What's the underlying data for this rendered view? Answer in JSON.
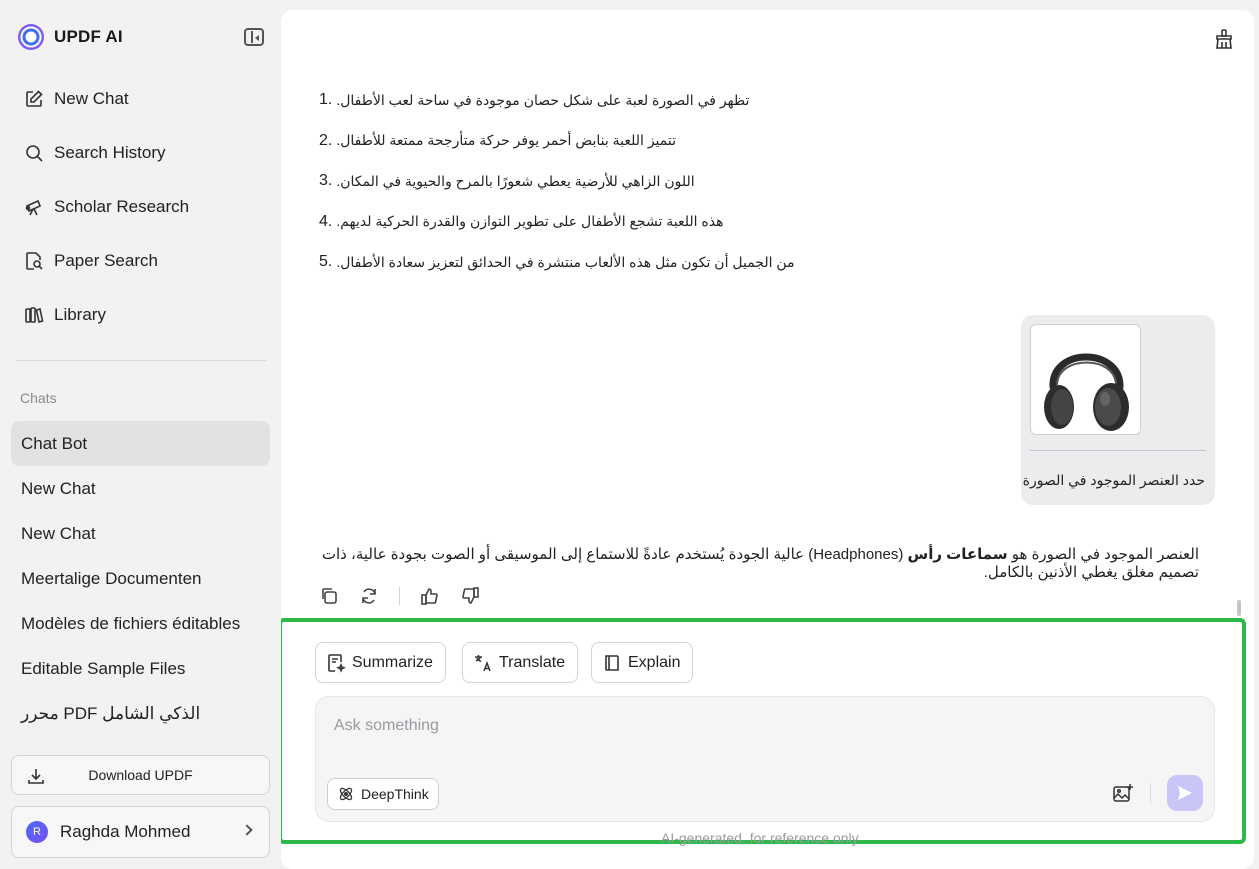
{
  "app": {
    "name": "UPDF AI"
  },
  "sidebar": {
    "nav": [
      {
        "label": "New Chat",
        "icon": "edit-icon"
      },
      {
        "label": "Search History",
        "icon": "search-icon"
      },
      {
        "label": "Scholar Research",
        "icon": "telescope-icon"
      },
      {
        "label": "Paper Search",
        "icon": "document-search-icon"
      },
      {
        "label": "Library",
        "icon": "library-icon"
      }
    ],
    "chats_label": "Chats",
    "chats": [
      "Chat Bot",
      "New Chat",
      "New Chat",
      "Meertalige Documenten",
      "Modèles de fichiers éditables",
      "Editable Sample Files",
      "محرر PDF الذكي الشامل"
    ],
    "active_chat_index": 0,
    "download_label": "Download UPDF",
    "user": {
      "initial": "R",
      "name": "Raghda Mohmed"
    }
  },
  "conversation": {
    "list_items": [
      {
        "num": "1.",
        "text": "تظهر في الصورة لعبة على شكل حصان موجودة في ساحة لعب الأطفال."
      },
      {
        "num": "2.",
        "text": "تتميز اللعبة بنابض أحمر يوفر حركة متأرجحة ممتعة للأطفال."
      },
      {
        "num": "3.",
        "text": "اللون الزاهي للأرضية يعطي شعورًا بالمرح والحيوية في المكان."
      },
      {
        "num": "4.",
        "text": "هذه اللعبة تشجع الأطفال على تطوير التوازن والقدرة الحركية لديهم."
      },
      {
        "num": "5.",
        "text": "من الجميل أن تكون مثل هذه الألعاب منتشرة في الحدائق لتعزيز سعادة الأطفال."
      }
    ],
    "user_message": {
      "image_alt": "headphones",
      "text": "حدد العنصر الموجود في الصورة"
    },
    "answer": {
      "bold": "سماعات رأس",
      "text_part1": "العنصر الموجود في الصورة هو ",
      "text_part2": " (Headphones) عالية الجودة يُستخدم عادةً للاستماع إلى الموسيقى أو الصوت بجودة عالية، ذات تصميم مغلق يغطي الأذنين بالكامل."
    }
  },
  "composer": {
    "quick_actions": [
      "Summarize",
      "Translate",
      "Explain"
    ],
    "placeholder": "Ask something",
    "deepthink_label": "DeepThink",
    "footnote": "AI-generated, for reference only"
  },
  "colors": {
    "highlight_border": "#2db84a",
    "send_button": "#c9c5f7",
    "active_chat_bg": "#e2e2e5"
  }
}
